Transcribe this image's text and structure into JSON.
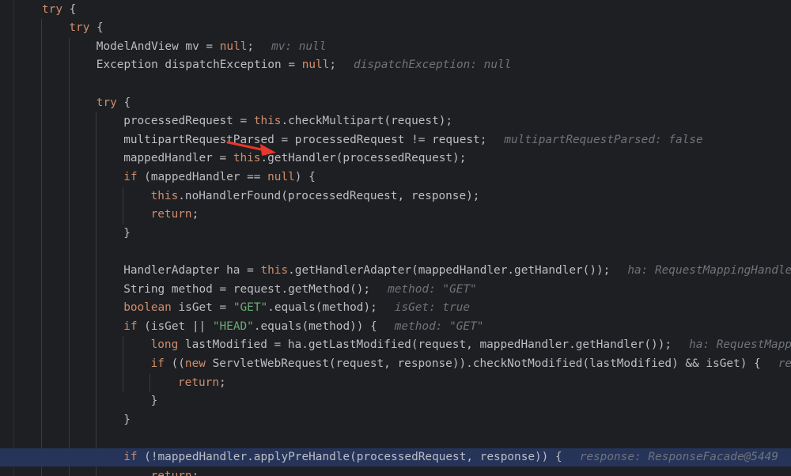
{
  "editor": {
    "colors": {
      "background": "#1e1f22",
      "keyword": "#cf8e6d",
      "string": "#6aab73",
      "text": "#bcbec4",
      "inlay_hint": "#6f737a",
      "current_line": "#26345a",
      "annotation_arrow": "#e8372c"
    },
    "annotation": "red-arrow-pointing-at-getHandler",
    "current_line_index": 24,
    "lines": [
      {
        "indent": 1,
        "tokens": [
          {
            "t": "kw",
            "v": "try"
          },
          {
            "t": "plain",
            "v": " {"
          }
        ],
        "hint": ""
      },
      {
        "indent": 2,
        "tokens": [
          {
            "t": "kw",
            "v": "try"
          },
          {
            "t": "plain",
            "v": " {"
          }
        ],
        "hint": ""
      },
      {
        "indent": 3,
        "tokens": [
          {
            "t": "plain",
            "v": "ModelAndView mv = "
          },
          {
            "t": "kw",
            "v": "null"
          },
          {
            "t": "plain",
            "v": ";"
          }
        ],
        "hint": "mv: null"
      },
      {
        "indent": 3,
        "tokens": [
          {
            "t": "plain",
            "v": "Exception dispatchException = "
          },
          {
            "t": "kw",
            "v": "null"
          },
          {
            "t": "plain",
            "v": ";"
          }
        ],
        "hint": "dispatchException: null"
      },
      {
        "indent": 3,
        "tokens": [],
        "hint": ""
      },
      {
        "indent": 3,
        "tokens": [
          {
            "t": "kw",
            "v": "try"
          },
          {
            "t": "plain",
            "v": " {"
          }
        ],
        "hint": ""
      },
      {
        "indent": 4,
        "tokens": [
          {
            "t": "plain",
            "v": "processedRequest = "
          },
          {
            "t": "kw",
            "v": "this"
          },
          {
            "t": "plain",
            "v": ".checkMultipart(request);"
          }
        ],
        "hint": ""
      },
      {
        "indent": 4,
        "tokens": [
          {
            "t": "plain",
            "v": "multipartRequestParsed = processedRequest != request;"
          }
        ],
        "hint": "multipartRequestParsed: false"
      },
      {
        "indent": 4,
        "tokens": [
          {
            "t": "plain",
            "v": "mappedHandler = "
          },
          {
            "t": "kw",
            "v": "this"
          },
          {
            "t": "plain",
            "v": ".getHandler(processedRequest);"
          }
        ],
        "hint": ""
      },
      {
        "indent": 4,
        "tokens": [
          {
            "t": "kw",
            "v": "if"
          },
          {
            "t": "plain",
            "v": " (mappedHandler == "
          },
          {
            "t": "kw",
            "v": "null"
          },
          {
            "t": "plain",
            "v": ") {"
          }
        ],
        "hint": ""
      },
      {
        "indent": 5,
        "tokens": [
          {
            "t": "kw",
            "v": "this"
          },
          {
            "t": "plain",
            "v": ".noHandlerFound(processedRequest, response);"
          }
        ],
        "hint": ""
      },
      {
        "indent": 5,
        "tokens": [
          {
            "t": "kw",
            "v": "return"
          },
          {
            "t": "plain",
            "v": ";"
          }
        ],
        "hint": ""
      },
      {
        "indent": 4,
        "tokens": [
          {
            "t": "plain",
            "v": "}"
          }
        ],
        "hint": ""
      },
      {
        "indent": 4,
        "tokens": [],
        "hint": ""
      },
      {
        "indent": 4,
        "tokens": [
          {
            "t": "plain",
            "v": "HandlerAdapter ha = "
          },
          {
            "t": "kw",
            "v": "this"
          },
          {
            "t": "plain",
            "v": ".getHandlerAdapter(mappedHandler.getHandler());"
          }
        ],
        "hint": "ha: RequestMappingHandler"
      },
      {
        "indent": 4,
        "tokens": [
          {
            "t": "plain",
            "v": "String method = request.getMethod();"
          }
        ],
        "hint": "method: \"GET\""
      },
      {
        "indent": 4,
        "tokens": [
          {
            "t": "kw",
            "v": "boolean"
          },
          {
            "t": "plain",
            "v": " isGet = "
          },
          {
            "t": "str",
            "v": "\"GET\""
          },
          {
            "t": "plain",
            "v": ".equals(method);"
          }
        ],
        "hint": "isGet: true"
      },
      {
        "indent": 4,
        "tokens": [
          {
            "t": "kw",
            "v": "if"
          },
          {
            "t": "plain",
            "v": " (isGet || "
          },
          {
            "t": "str",
            "v": "\"HEAD\""
          },
          {
            "t": "plain",
            "v": ".equals(method)) {"
          }
        ],
        "hint": "method: \"GET\""
      },
      {
        "indent": 5,
        "tokens": [
          {
            "t": "kw",
            "v": "long"
          },
          {
            "t": "plain",
            "v": " lastModified = ha.getLastModified(request, mappedHandler.getHandler());"
          }
        ],
        "hint": "ha: RequestMappi"
      },
      {
        "indent": 5,
        "tokens": [
          {
            "t": "kw",
            "v": "if"
          },
          {
            "t": "plain",
            "v": " (("
          },
          {
            "t": "kw",
            "v": "new"
          },
          {
            "t": "plain",
            "v": " ServletWebRequest(request, response)).checkNotModified(lastModified) && isGet) {"
          }
        ],
        "hint": "req"
      },
      {
        "indent": 6,
        "tokens": [
          {
            "t": "kw",
            "v": "return"
          },
          {
            "t": "plain",
            "v": ";"
          }
        ],
        "hint": ""
      },
      {
        "indent": 5,
        "tokens": [
          {
            "t": "plain",
            "v": "}"
          }
        ],
        "hint": ""
      },
      {
        "indent": 4,
        "tokens": [
          {
            "t": "plain",
            "v": "}"
          }
        ],
        "hint": ""
      },
      {
        "indent": 4,
        "tokens": [],
        "hint": ""
      },
      {
        "indent": 4,
        "tokens": [
          {
            "t": "kw",
            "v": "if"
          },
          {
            "t": "plain",
            "v": " (!mappedHandler.applyPreHandle(processedRequest, response)) {"
          }
        ],
        "hint": "response: ResponseFacade@5449"
      },
      {
        "indent": 5,
        "tokens": [
          {
            "t": "kw",
            "v": "return"
          },
          {
            "t": "plain",
            "v": ";"
          }
        ],
        "hint": ""
      }
    ]
  }
}
